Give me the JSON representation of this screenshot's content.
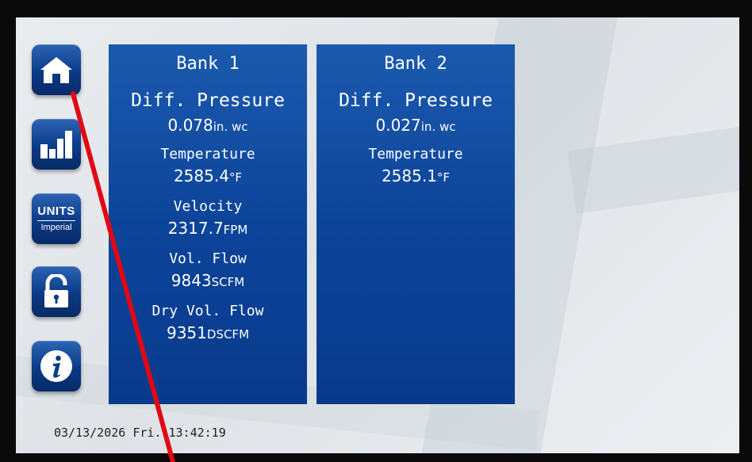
{
  "nav": {
    "units_label": "UNITS",
    "units_mode": "Imperial"
  },
  "banks": [
    {
      "title": "Bank 1",
      "diff_pressure": {
        "label": "Diff. Pressure",
        "value": "0.078",
        "unit": "in. wc"
      },
      "temperature": {
        "label": "Temperature",
        "value": "2585.4",
        "unit": "°F"
      },
      "velocity": {
        "label": "Velocity",
        "value": "2317.7",
        "unit": "FPM"
      },
      "vol_flow": {
        "label": "Vol. Flow",
        "value": "9843",
        "unit": "SCFM"
      },
      "dry_vol_flow": {
        "label": "Dry Vol. Flow",
        "value": "9351",
        "unit": "DSCFM"
      }
    },
    {
      "title": "Bank 2",
      "diff_pressure": {
        "label": "Diff. Pressure",
        "value": "0.027",
        "unit": "in. wc"
      },
      "temperature": {
        "label": "Temperature",
        "value": "2585.1",
        "unit": "°F"
      }
    }
  ],
  "status": {
    "date": "03/13/2026",
    "day": "Fri.",
    "time": "13:42:19"
  },
  "colors": {
    "panel": "#0c449a",
    "button": "#0b3a86",
    "pointer": "#e30613"
  }
}
